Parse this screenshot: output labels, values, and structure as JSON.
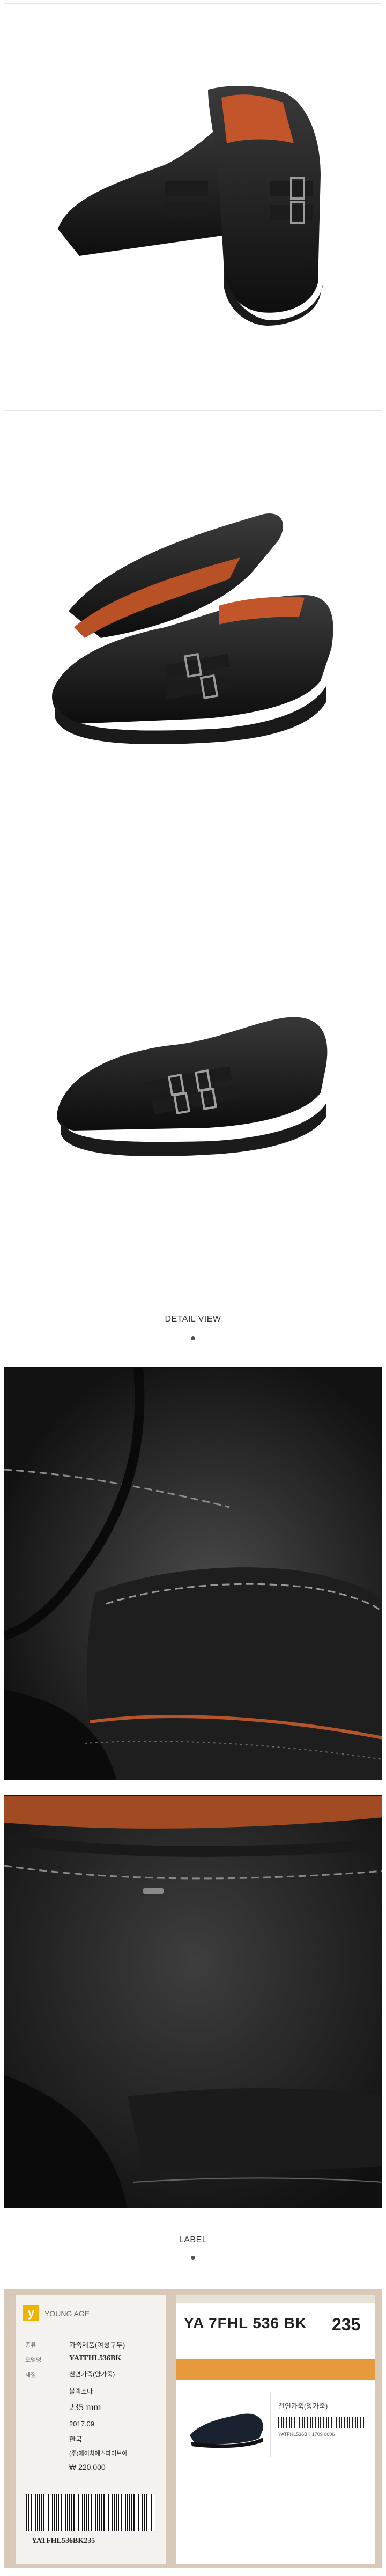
{
  "sections": {
    "detail_title": "DETAIL VIEW",
    "label_title": "LABEL"
  },
  "label_card_left": {
    "brand": "YOUNG AGE",
    "line1_key": "종류",
    "line1_value": "가죽제품(여성구두)",
    "line2_key": "모델명",
    "line2_value": "YATFHL536BK",
    "line3_key": "재질",
    "line3_value": "천연가죽(양가죽)",
    "color_value": "블랙소다",
    "size_value": "235 mm",
    "date_value": "2017.09",
    "origin_value": "한국",
    "maker_value": "(주)에이치에스파이브아",
    "price_value": "₩ 220,000",
    "barcode_text": "YATFHL536BK235"
  },
  "label_card_right": {
    "model": "YA 7FHL 536 BK",
    "size": "235",
    "material": "천연가죽(양가죽)",
    "barcode_caption": "YATFHL536BK 1709 0606"
  }
}
